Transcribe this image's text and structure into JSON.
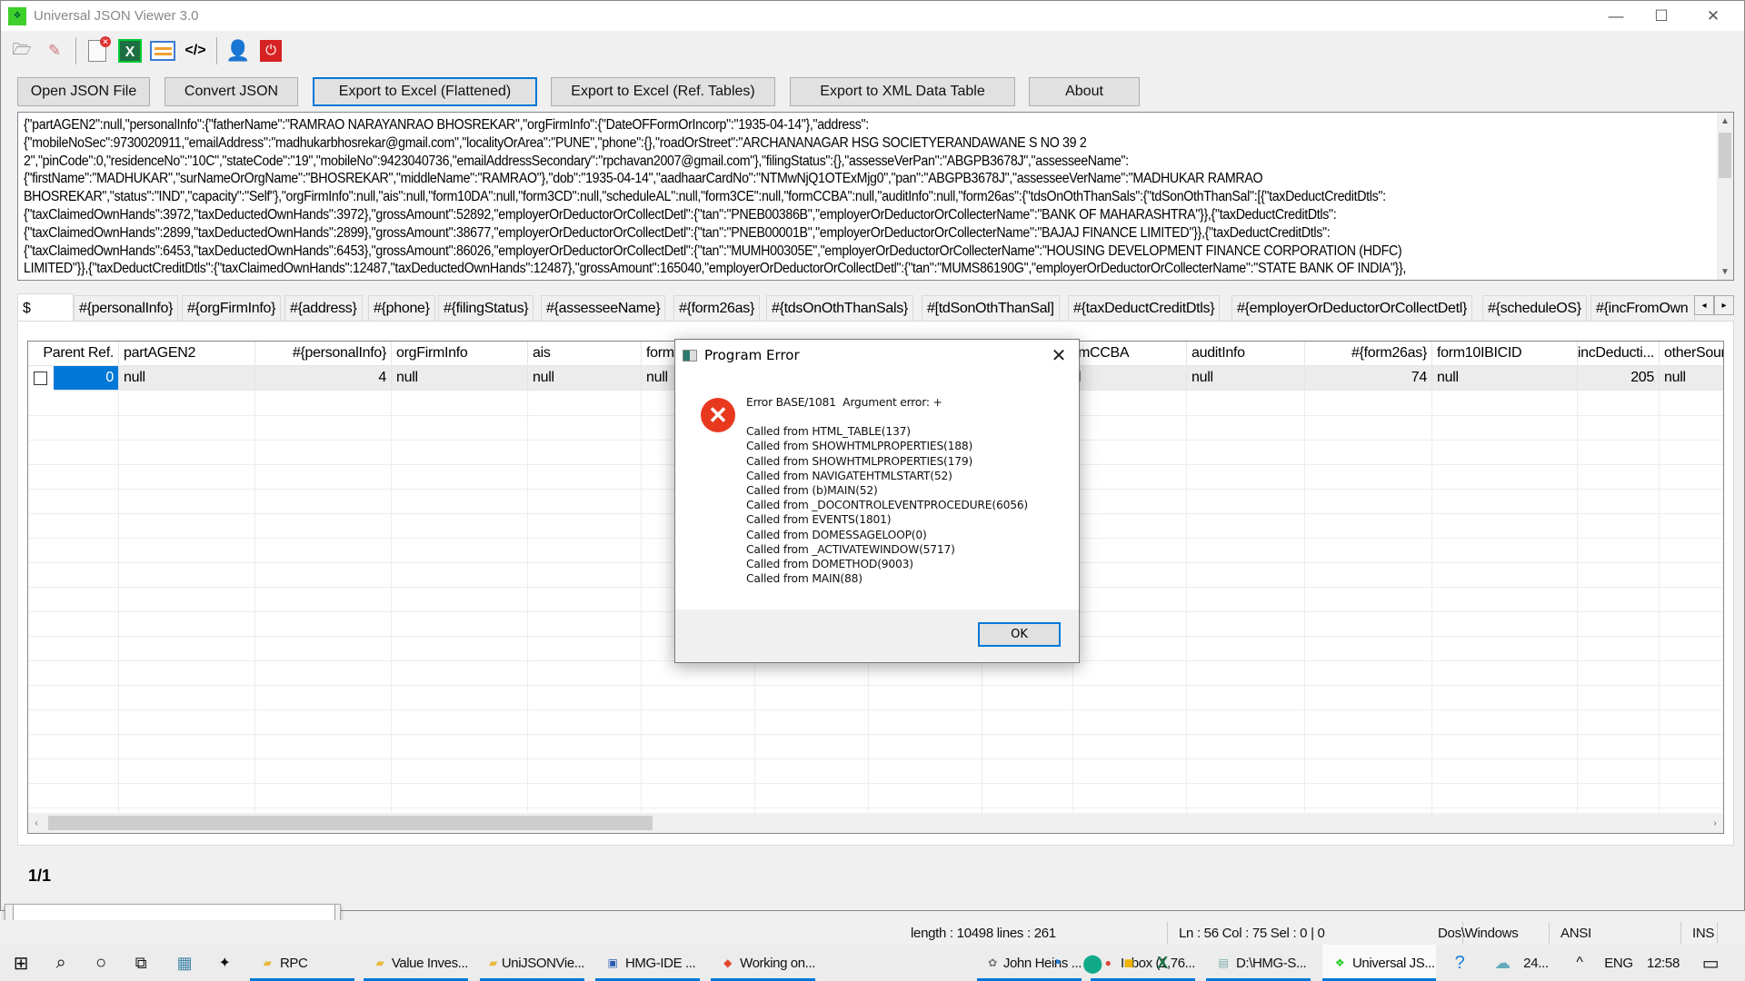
{
  "window": {
    "title": "Universal JSON Viewer 3.0",
    "controls": {
      "minimize": "—",
      "maximize": "☐",
      "close": "✕"
    }
  },
  "toolbar": {
    "icons": [
      "open-folder-icon",
      "edit-icon",
      "close-document-icon",
      "excel-icon",
      "list-icon",
      "code-icon",
      "user-icon",
      "power-icon"
    ]
  },
  "buttons": {
    "open_json": "Open JSON File",
    "convert_json": "Convert JSON",
    "export_flat": "Export to Excel (Flattened)",
    "export_ref": "Export to Excel (Ref. Tables)",
    "export_xml": "Export to XML Data Table",
    "about": "About"
  },
  "json_text": "{\"partAGEN2\":null,\"personalInfo\":{\"fatherName\":\"RAMRAO NARAYANRAO BHOSREKAR\",\"orgFirmInfo\":{\"DateOFFormOrIncorp\":\"1935-04-14\"},\"address\":\n{\"mobileNoSec\":9730020911,\"emailAddress\":\"madhukarbhosrekar@gmail.com\",\"localityOrArea\":\"PUNE\",\"phone\":{},\"roadOrStreet\":\"ARCHANANAGAR HSG SOCIETYERANDAWANE S NO 39 2\n2\",\"pinCode\":0,\"residenceNo\":\"10C\",\"stateCode\":\"19\",\"mobileNo\":9423040736,\"emailAddressSecondary\":\"rpchavan2007@gmail.com\"},\"filingStatus\":{},\"assesseVerPan\":\"ABGPB3678J\",\"assesseeName\":\n{\"firstName\":\"MADHUKAR\",\"surNameOrOrgName\":\"BHOSREKAR\",\"middleName\":\"RAMRAO\"},\"dob\":\"1935-04-14\",\"aadhaarCardNo\":\"NTMwNjQ1OTExMjg0\",\"pan\":\"ABGPB3678J\",\"assesseeVerName\":\"MADHUKAR RAMRAO\nBHOSREKAR\",\"status\":\"IND\",\"capacity\":\"Self\"},\"orgFirmInfo\":null,\"ais\":null,\"form10DA\":null,\"form3CD\":null,\"scheduleAL\":null,\"form3CE\":null,\"formCCBA\":null,\"auditInfo\":null,\"form26as\":{\"tdsOnOthThanSals\":{\"tdSonOthThanSal\":[{\"taxDeductCreditDtls\":\n{\"taxClaimedOwnHands\":3972,\"taxDeductedOwnHands\":3972},\"grossAmount\":52892,\"employerOrDeductorOrCollectDetl\":{\"tan\":\"PNEB00386B\",\"employerOrDeductorOrCollecterName\":\"BANK OF MAHARASHTRA\"}},{\"taxDeductCreditDtls\":\n{\"taxClaimedOwnHands\":2899,\"taxDeductedOwnHands\":2899},\"grossAmount\":38677,\"employerOrDeductorOrCollectDetl\":{\"tan\":\"PNEB00001B\",\"employerOrDeductorOrCollecterName\":\"BAJAJ FINANCE LIMITED\"}},{\"taxDeductCreditDtls\":\n{\"taxClaimedOwnHands\":6453,\"taxDeductedOwnHands\":6453},\"grossAmount\":86026,\"employerOrDeductorOrCollectDetl\":{\"tan\":\"MUMH00305E\",\"employerOrDeductorOrCollecterName\":\"HOUSING DEVELOPMENT FINANCE CORPORATION (HDFC)\nLIMITED\"}},{\"taxDeductCreditDtls\":{\"taxClaimedOwnHands\":12487,\"taxDeductedOwnHands\":12487},\"grossAmount\":165040,\"employerOrDeductorOrCollectDetl\":{\"tan\":\"MUMS86190G\",\"employerOrDeductorOrCollecterName\":\"STATE BANK OF INDIA\"}},",
  "tabs": [
    "$",
    "#{personalInfo}",
    "#{orgFirmInfo}",
    "#{address}",
    "#{phone}",
    "#{filingStatus}",
    "#{assesseeName}",
    "#{form26as}",
    "#{tdsOnOthThanSals}",
    "#[tdSonOthThanSal]",
    "#{taxDeductCreditDtls}",
    "#{employerOrDeductorOrCollectDetl}",
    "#{scheduleOS}",
    "#{incFromOwn"
  ],
  "tab_nav": {
    "prev": "◂",
    "next": "▸"
  },
  "grid": {
    "columns": [
      "Parent Ref.",
      "partAGEN2",
      "#{personalInfo}",
      "orgFirmInfo",
      "ais",
      "form10DA",
      "",
      "",
      "",
      "mCCBA",
      "auditInfo",
      "#{form26as}",
      "form10IBICID",
      "#[incDeducti...",
      "otherSourceI..."
    ],
    "row": [
      "0",
      "null",
      "4",
      "null",
      "null",
      "null",
      "",
      "",
      "",
      "l",
      "null",
      "74",
      "null",
      "205",
      "null"
    ]
  },
  "pager": "1/1",
  "statusbar": {
    "length": "length : 10498   lines : 261",
    "position": "Ln : 56   Col : 75   Sel : 0 | 0",
    "eol": "Dos\\Windows",
    "encoding": "ANSI",
    "mode": "INS"
  },
  "dialog": {
    "title": "Program Error",
    "close": "✕",
    "error_line": "Error BASE/1081  Argument error: +",
    "stack": [
      "Called from HTML_TABLE(137)",
      "Called from SHOWHTMLPROPERTIES(188)",
      "Called from SHOWHTMLPROPERTIES(179)",
      "Called from NAVIGATEHTMLSTART(52)",
      "Called from (b)MAIN(52)",
      "Called from _DOCONTROLEVENTPROCEDURE(6056)",
      "Called from EVENTS(1801)",
      "Called from DOMESSAGELOOP(0)",
      "Called from _ACTIVATEWINDOW(5717)",
      "Called from DOMETHOD(9003)",
      "Called from MAIN(88)"
    ],
    "ok": "OK"
  },
  "taskbar": {
    "apps": [
      {
        "label": "RPC",
        "icon": "folder-icon"
      },
      {
        "label": "Value Inves...",
        "icon": "folder-icon"
      },
      {
        "label": "UniJSONVie...",
        "icon": "folder-icon"
      },
      {
        "label": "HMG-IDE  ...",
        "icon": "hmg-ide-icon"
      },
      {
        "label": "Working on...",
        "icon": "brave-icon"
      },
      {
        "label": "John Heins ...",
        "icon": "app-icon"
      },
      {
        "label": "Inbox (1,76...",
        "icon": "chrome-icon"
      },
      {
        "label": "D:\\HMG-S...",
        "icon": "notepad-icon"
      },
      {
        "label": "Universal JS...",
        "icon": "json-viewer-icon"
      }
    ],
    "weather": "24...",
    "language": "ENG",
    "clock": "12:58",
    "accent": "#0078d7"
  }
}
